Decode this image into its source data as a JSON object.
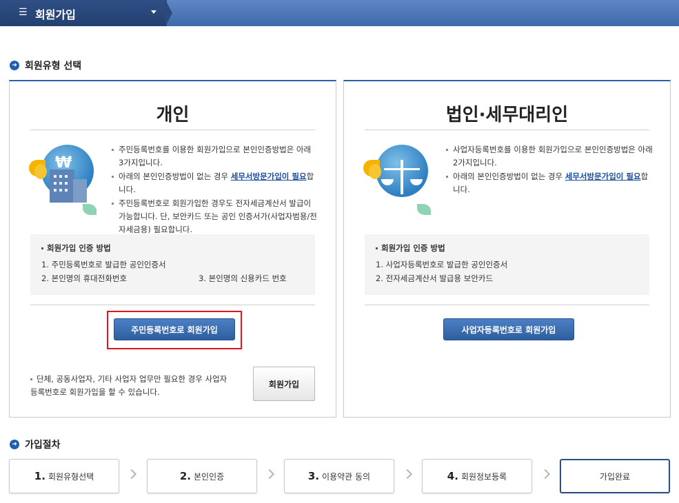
{
  "header": {
    "menu_title": "회원가입",
    "menu_icon": "hamburger-icon",
    "caret_icon": "caret-down-icon"
  },
  "section1": {
    "title": "회원유형 선택"
  },
  "individual": {
    "title": "개인",
    "desc": [
      "주민등록번호를 이용한 회원가입으로 본인인증방법은 아래 3가지입니다.",
      "아래의 본인인증방법이 없는 경우 ",
      "세무서방문가입이 필요",
      "합니다.",
      "주민등록번호로 회원가입한 경우도 전자세금계산서 발급이 가능합니다. 단, 보안카드 또는 공인 인증서가(사업자범용/전자세금용) 필요합니다."
    ],
    "auth_title": "회원가입 인증 방법",
    "auth_items": [
      "1. 주민등록번호로 발급한 공인인증서",
      "2. 본인명의 휴대전화번호",
      "3. 본인명의 신용카드 번호"
    ],
    "signup_button": "주민등록번호로 회원가입",
    "note": "단체, 공동사업자, 기타 사업자 업무만 필요한 경우 사업자등록번호로 회원가입을 할 수 있습니다.",
    "join_button": "회원가입"
  },
  "corporate": {
    "title": "법인·세무대리인",
    "desc": [
      "사업자등록번호를 이용한 회원가입으로 본인인증방법은 아래 2가지입니다.",
      "아래의 본인인증방법이 없는 경우 ",
      "세무서방문가입이 필요",
      "합니다."
    ],
    "auth_title": "회원가입 인증 방법",
    "auth_items": [
      "1. 사업자등록번호로 발급한 공인인증서",
      "2. 전자세금계산서 발급용 보안카드"
    ],
    "signup_button": "사업자등록번호로 회원가입"
  },
  "section2": {
    "title": "가입절차"
  },
  "steps": [
    {
      "num": "1.",
      "label": "회원유형선택"
    },
    {
      "num": "2.",
      "label": "본인인증"
    },
    {
      "num": "3.",
      "label": "이용약관 동의"
    },
    {
      "num": "4.",
      "label": "회원정보등록"
    },
    {
      "num": "",
      "label": "가입완료"
    }
  ]
}
